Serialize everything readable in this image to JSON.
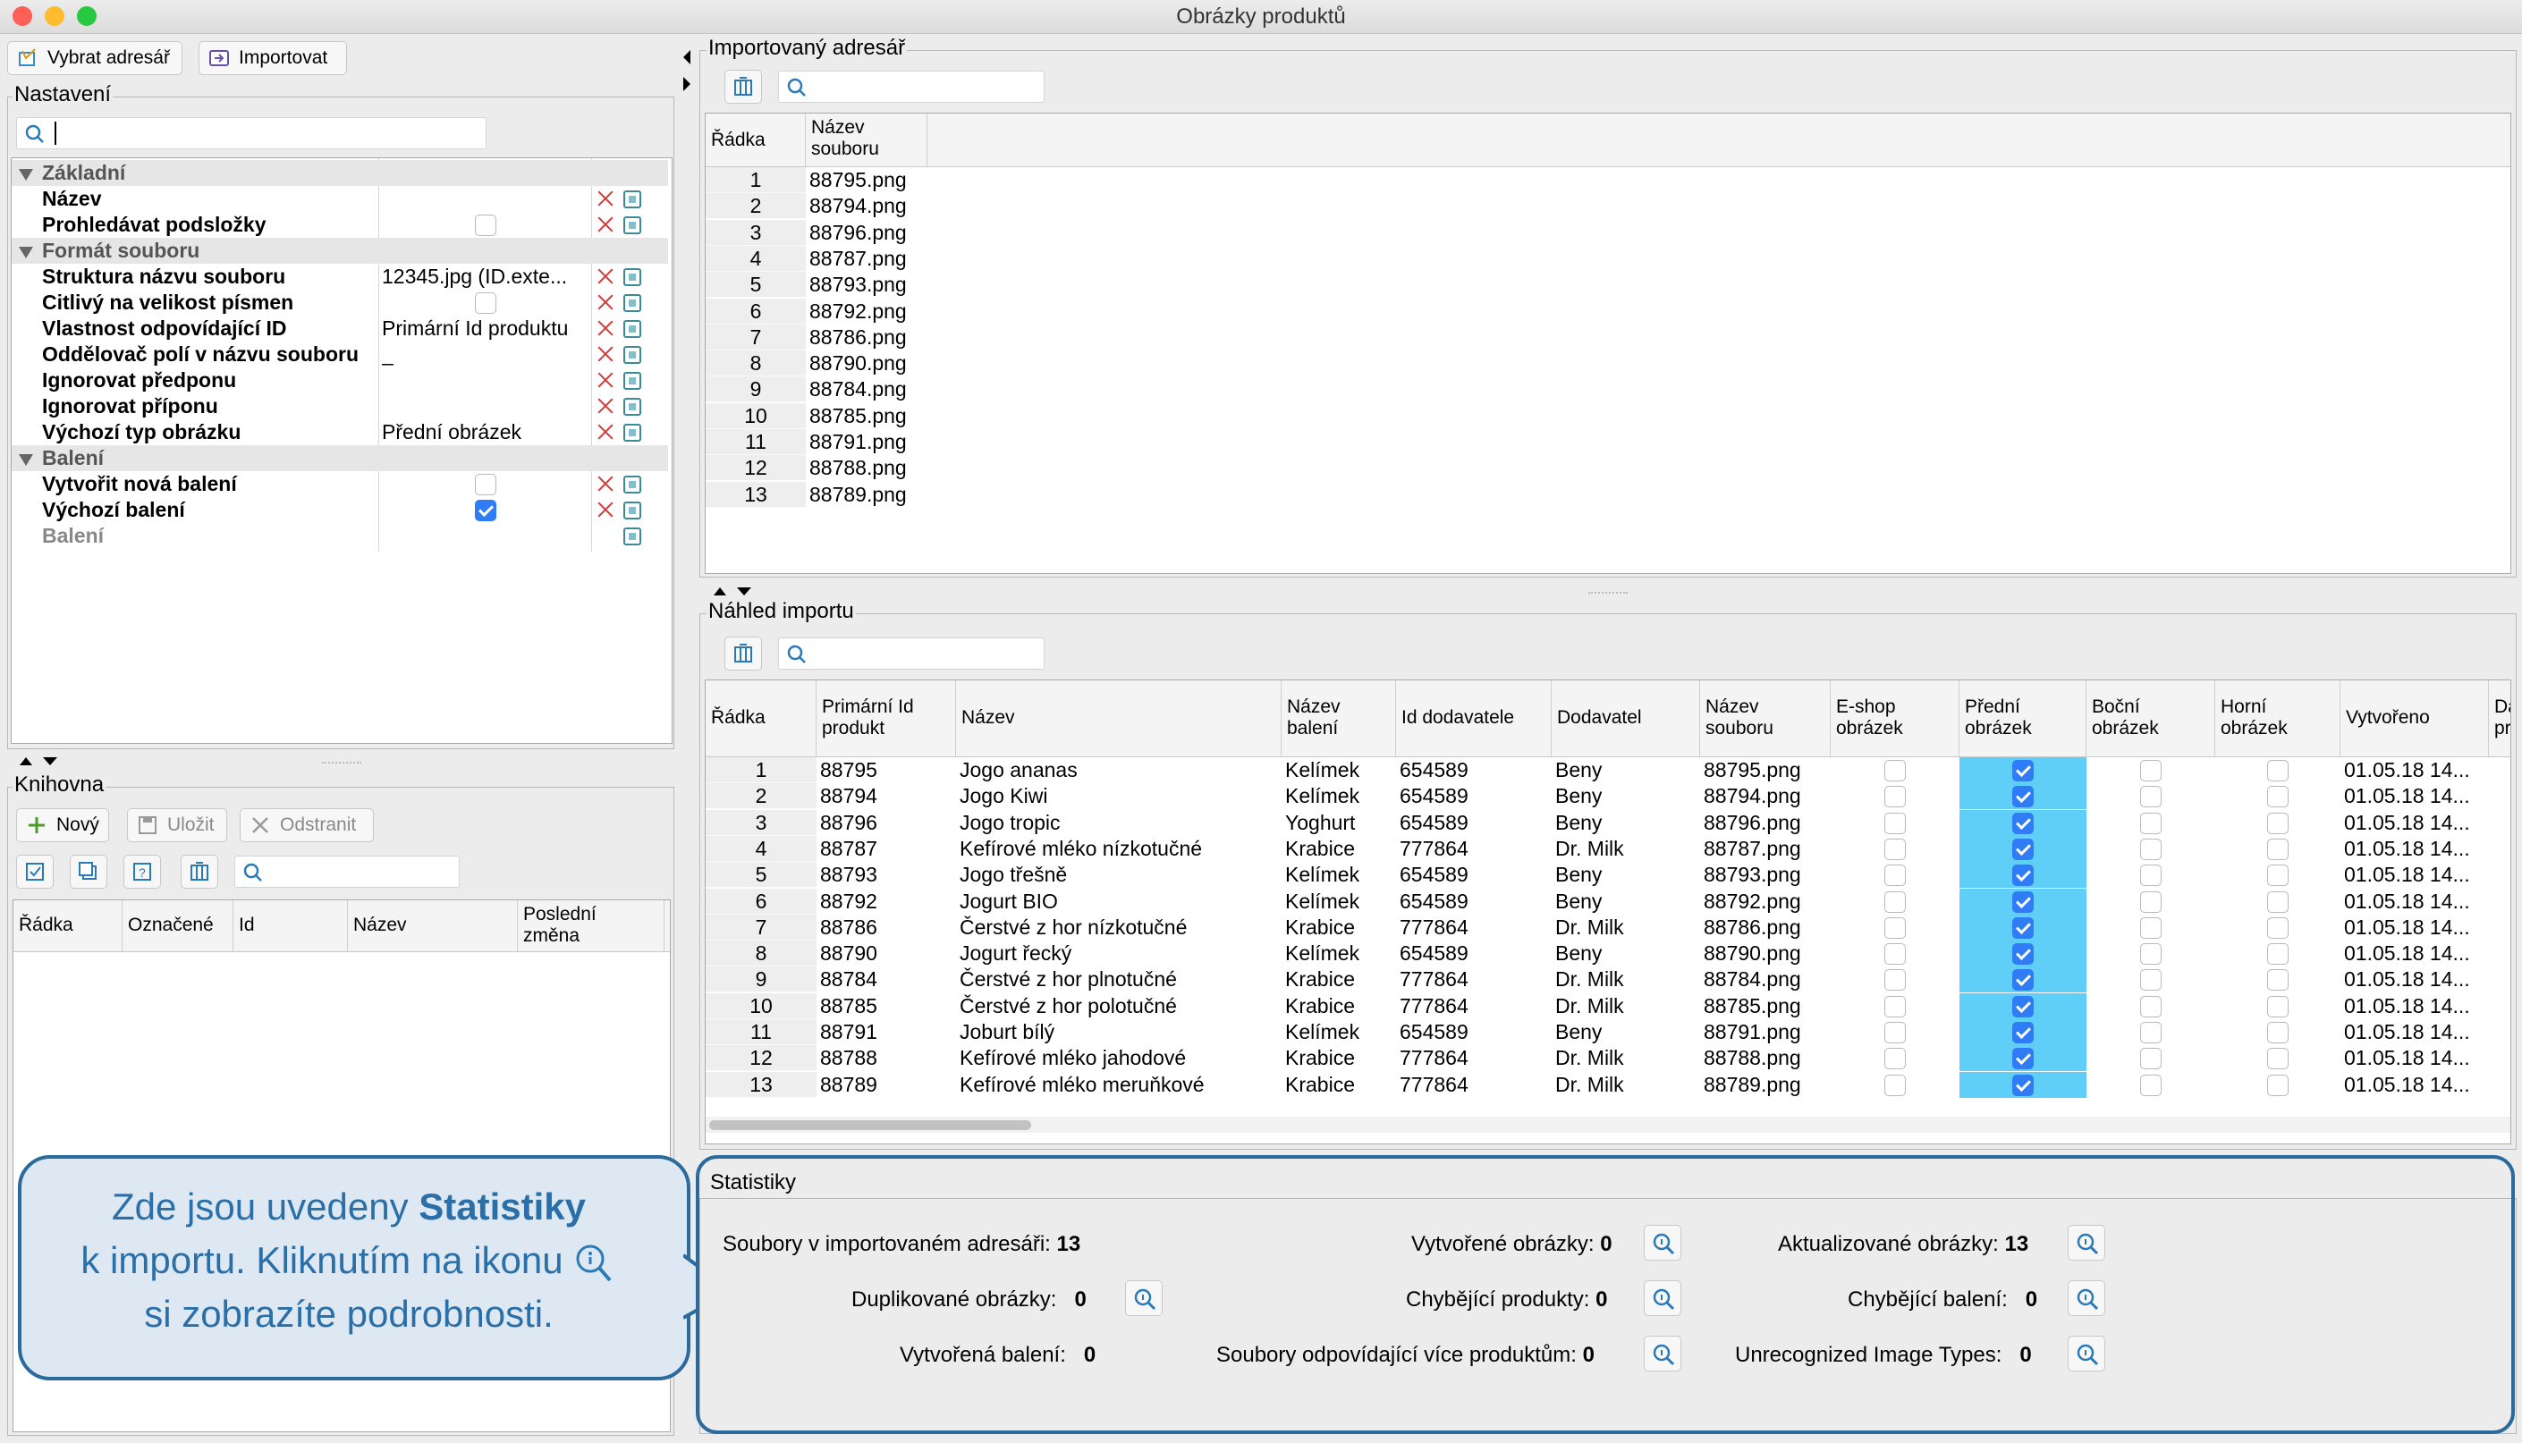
{
  "window": {
    "title": "Obrázky produktů"
  },
  "toolbar": {
    "select_dir": "Vybrat adresář",
    "import": "Importovat"
  },
  "settings": {
    "title": "Nastavení",
    "categories": {
      "basic": "Základní",
      "format": "Formát souboru",
      "packaging": "Balení"
    },
    "props": [
      {
        "name": "Název",
        "value": ""
      },
      {
        "name": "Prohledávat podsložky",
        "value": ""
      },
      {
        "name": "Struktura názvu souboru",
        "value": "12345.jpg (ID.exte..."
      },
      {
        "name": "Citlivý na velikost písmen",
        "value": ""
      },
      {
        "name": "Vlastnost odpovídající ID",
        "value": "Primární Id produktu"
      },
      {
        "name": "Oddělovač polí v názvu souboru",
        "value": "_"
      },
      {
        "name": "Ignorovat předponu",
        "value": ""
      },
      {
        "name": "Ignorovat příponu",
        "value": ""
      },
      {
        "name": "Výchozí typ obrázku",
        "value": "Přední obrázek"
      },
      {
        "name": "Vytvořit nová balení",
        "value": ""
      },
      {
        "name": "Výchozí balení",
        "value": ""
      },
      {
        "name": "Balení",
        "value": ""
      }
    ],
    "checkbox_states": {
      "subfolders": false,
      "case_sensitive": false,
      "create_packaging": false,
      "default_packaging": true
    }
  },
  "library": {
    "title": "Knihovna",
    "new": "Nový",
    "save": "Uložit",
    "remove": "Odstranit",
    "columns": [
      "Řádka",
      "Označené",
      "Id",
      "Název",
      "Poslední\nzměna"
    ]
  },
  "imported": {
    "title": "Importovaný adresář",
    "columns": [
      "Řádka",
      "Název\nsouboru"
    ],
    "rows": [
      [
        "1",
        "88795.png"
      ],
      [
        "2",
        "88794.png"
      ],
      [
        "3",
        "88796.png"
      ],
      [
        "4",
        "88787.png"
      ],
      [
        "5",
        "88793.png"
      ],
      [
        "6",
        "88792.png"
      ],
      [
        "7",
        "88786.png"
      ],
      [
        "8",
        "88790.png"
      ],
      [
        "9",
        "88784.png"
      ],
      [
        "10",
        "88785.png"
      ],
      [
        "11",
        "88791.png"
      ],
      [
        "12",
        "88788.png"
      ],
      [
        "13",
        "88789.png"
      ]
    ]
  },
  "preview": {
    "title": "Náhled importu",
    "columns": [
      "Řádka",
      "Primární Id\nprodukt",
      "Název",
      "Název\nbalení",
      "Id dodavatele",
      "Dodavatel",
      "Název\nsouboru",
      "E-shop\nobrázek",
      "Přední\nobrázek",
      "Boční\nobrázek",
      "Horní\nobrázek",
      "Vytvořeno",
      "Da\npr"
    ],
    "rows": [
      [
        "1",
        "88795",
        "Jogo ananas",
        "Kelímek",
        "654589",
        "Beny",
        "88795.png",
        "01.05.18 14..."
      ],
      [
        "2",
        "88794",
        "Jogo Kiwi",
        "Kelímek",
        "654589",
        "Beny",
        "88794.png",
        "01.05.18 14..."
      ],
      [
        "3",
        "88796",
        "Jogo tropic",
        "Yoghurt",
        "654589",
        "Beny",
        "88796.png",
        "01.05.18 14..."
      ],
      [
        "4",
        "88787",
        "Kefírové mléko nízkotučné",
        "Krabice",
        "777864",
        "Dr. Milk",
        "88787.png",
        "01.05.18 14..."
      ],
      [
        "5",
        "88793",
        "Jogo třešně",
        "Kelímek",
        "654589",
        "Beny",
        "88793.png",
        "01.05.18 14..."
      ],
      [
        "6",
        "88792",
        "Jogurt BIO",
        "Kelímek",
        "654589",
        "Beny",
        "88792.png",
        "01.05.18 14..."
      ],
      [
        "7",
        "88786",
        "Čerstvé z hor nízkotučné",
        "Krabice",
        "777864",
        "Dr. Milk",
        "88786.png",
        "01.05.18 14..."
      ],
      [
        "8",
        "88790",
        "Jogurt řecký",
        "Kelímek",
        "654589",
        "Beny",
        "88790.png",
        "01.05.18 14..."
      ],
      [
        "9",
        "88784",
        "Čerstvé z hor plnotučné",
        "Krabice",
        "777864",
        "Dr. Milk",
        "88784.png",
        "01.05.18 14..."
      ],
      [
        "10",
        "88785",
        "Čerstvé z hor polotučné",
        "Krabice",
        "777864",
        "Dr. Milk",
        "88785.png",
        "01.05.18 14..."
      ],
      [
        "11",
        "88791",
        "Joburt bílý",
        "Kelímek",
        "654589",
        "Beny",
        "88791.png",
        "01.05.18 14..."
      ],
      [
        "12",
        "88788",
        "Kefírové mléko jahodové",
        "Krabice",
        "777864",
        "Dr. Milk",
        "88788.png",
        "01.05.18 14..."
      ],
      [
        "13",
        "88789",
        "Kefírové mléko meruňkové",
        "Krabice",
        "777864",
        "Dr. Milk",
        "88789.png",
        "01.05.18 14..."
      ]
    ],
    "front_image_checked": true,
    "highlight_color": "#5fcff7"
  },
  "stats": {
    "title": "Statistiky",
    "files_label": "Soubory v importovaném adresáři:",
    "files": "13",
    "duplicates_label": "Duplikované obrázky:",
    "duplicates": "0",
    "created_pack_label": "Vytvořená balení:",
    "created_pack": "0",
    "created_img_label": "Vytvořené obrázky:",
    "created_img": "0",
    "missing_prod_label": "Chybějící produkty:",
    "missing_prod": "0",
    "multi_label": "Soubory odpovídající více produktům:",
    "multi": "0",
    "updated_label": "Aktualizované obrázky:",
    "updated": "13",
    "missing_pack_label": "Chybějící balení:",
    "missing_pack": "0",
    "unrec_label": "Unrecognized Image Types:",
    "unrec": "0"
  },
  "callout": {
    "line1": "Zde jsou uvedeny ",
    "bold": "Statistiky",
    "line2": "k importu. Kliknutím na ikonu",
    "line3": "si zobrazíte podrobnosti."
  },
  "colors": {
    "accent": "#2b6a9c",
    "check": "#2f7cf6"
  }
}
